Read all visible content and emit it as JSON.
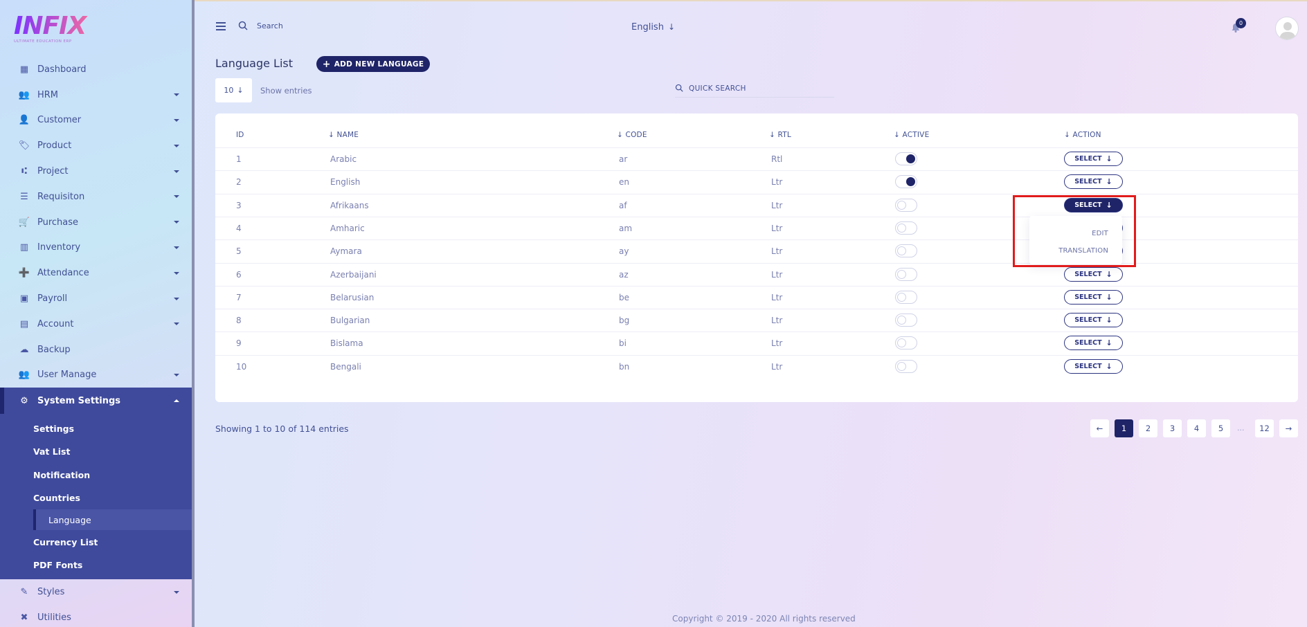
{
  "logo": {
    "word": "INFIX",
    "tagline": "ULTIMATE EDUCATION ERP"
  },
  "sidebar": {
    "items": [
      {
        "label": "Dashboard",
        "icon": "grid-icon",
        "has_caret": false
      },
      {
        "label": "HRM",
        "icon": "users-icon",
        "has_caret": true
      },
      {
        "label": "Customer",
        "icon": "user-icon",
        "has_caret": true
      },
      {
        "label": "Product",
        "icon": "tags-icon",
        "has_caret": true
      },
      {
        "label": "Project",
        "icon": "project-diagram-icon",
        "has_caret": true
      },
      {
        "label": "Requisiton",
        "icon": "list-icon",
        "has_caret": true
      },
      {
        "label": "Purchase",
        "icon": "cart-icon",
        "has_caret": true
      },
      {
        "label": "Inventory",
        "icon": "barcode-icon",
        "has_caret": true
      },
      {
        "label": "Attendance",
        "icon": "user-plus-icon",
        "has_caret": true
      },
      {
        "label": "Payroll",
        "icon": "money-icon",
        "has_caret": true
      },
      {
        "label": "Account",
        "icon": "calculator-icon",
        "has_caret": true
      },
      {
        "label": "Backup",
        "icon": "cloud-download-icon",
        "has_caret": false
      },
      {
        "label": "User Manage",
        "icon": "users-icon",
        "has_caret": true
      },
      {
        "label": "System Settings",
        "icon": "gear-icon",
        "has_caret": true
      }
    ],
    "submenu": [
      "Settings",
      "Vat List",
      "Notification",
      "Countries",
      "Language",
      "Currency List",
      "PDF Fonts"
    ],
    "bottom_items": [
      {
        "label": "Styles",
        "icon": "brush-icon",
        "has_caret": true
      },
      {
        "label": "Utilities",
        "icon": "tools-icon",
        "has_caret": false
      }
    ]
  },
  "header": {
    "search_placeholder": "Search",
    "language": "English",
    "notification_count": "0"
  },
  "page": {
    "title": "Language List",
    "add_button": "ADD NEW LANGUAGE",
    "entries_value": "10",
    "entries_label": "Show entries",
    "quick_search": "QUICK SEARCH"
  },
  "table": {
    "headers": [
      "ID",
      "NAME",
      "CODE",
      "RTL",
      "ACTIVE",
      "ACTION"
    ],
    "select_label": "SELECT",
    "rows": [
      {
        "id": "1",
        "name": "Arabic",
        "code": "ar",
        "rtl": "Rtl",
        "active": true
      },
      {
        "id": "2",
        "name": "English",
        "code": "en",
        "rtl": "Ltr",
        "active": true
      },
      {
        "id": "3",
        "name": "Afrikaans",
        "code": "af",
        "rtl": "Ltr",
        "active": false
      },
      {
        "id": "4",
        "name": "Amharic",
        "code": "am",
        "rtl": "Ltr",
        "active": false
      },
      {
        "id": "5",
        "name": "Aymara",
        "code": "ay",
        "rtl": "Ltr",
        "active": false
      },
      {
        "id": "6",
        "name": "Azerbaijani",
        "code": "az",
        "rtl": "Ltr",
        "active": false
      },
      {
        "id": "7",
        "name": "Belarusian",
        "code": "be",
        "rtl": "Ltr",
        "active": false
      },
      {
        "id": "8",
        "name": "Bulgarian",
        "code": "bg",
        "rtl": "Ltr",
        "active": false
      },
      {
        "id": "9",
        "name": "Bislama",
        "code": "bi",
        "rtl": "Ltr",
        "active": false
      },
      {
        "id": "10",
        "name": "Bengali",
        "code": "bn",
        "rtl": "Ltr",
        "active": false
      }
    ],
    "dropdown": [
      "EDIT",
      "TRANSLATION"
    ]
  },
  "footer": {
    "showing": "Showing 1 to 10 of 114 entries",
    "pages": [
      "1",
      "2",
      "3",
      "4",
      "5",
      "12"
    ],
    "ellipsis": "...",
    "current_page": "1",
    "copyright": "Copyright © 2019 - 2020 All rights reserved"
  },
  "colors": {
    "accent": "#1f2468",
    "sidebar_active": "#3f4a9c",
    "highlight": "#e11b1b"
  }
}
